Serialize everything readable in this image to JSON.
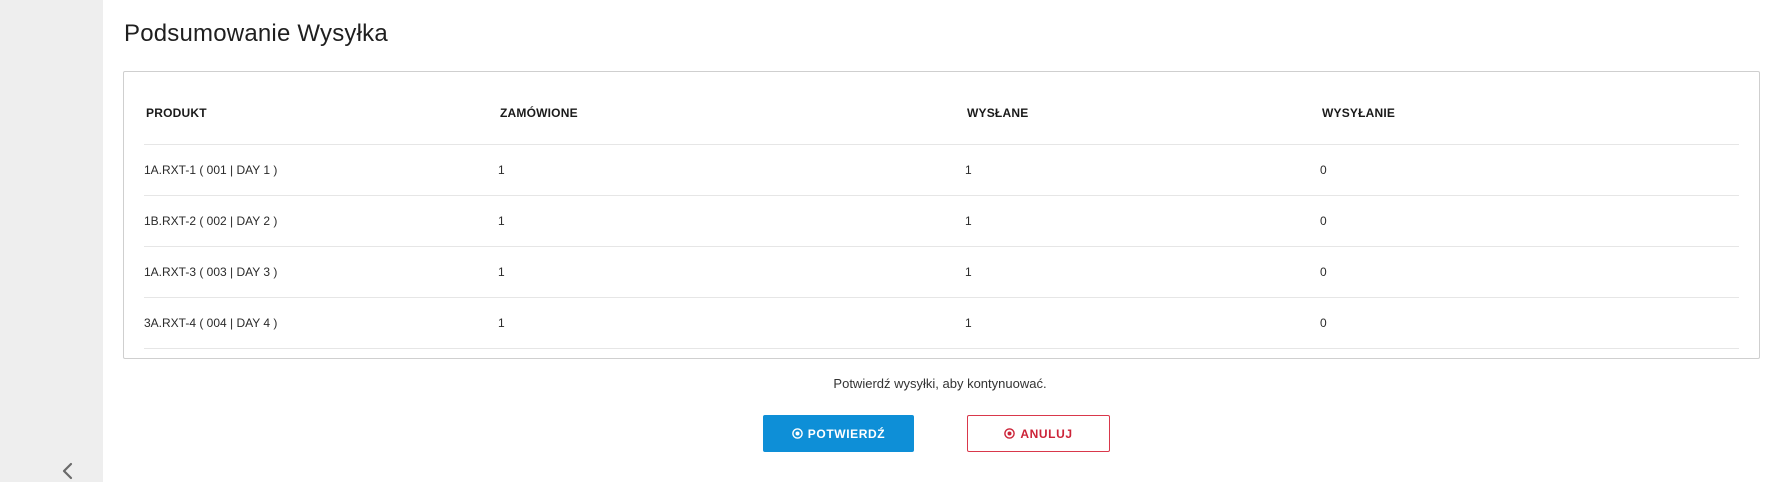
{
  "page": {
    "title": "Podsumowanie Wysyłka",
    "hint": "Potwierdź wysyłki, aby kontynuować."
  },
  "table": {
    "headers": {
      "product": "PRODUKT",
      "ordered": "ZAMÓWIONE",
      "shipped": "WYSŁANE",
      "shipping": "WYSYŁANIE"
    },
    "rows": [
      {
        "product": "1A.RXT-1 ( 001 | DAY 1 )",
        "ordered": "1",
        "shipped": "1",
        "shipping": "0"
      },
      {
        "product": "1B.RXT-2 ( 002 | DAY 2 )",
        "ordered": "1",
        "shipped": "1",
        "shipping": "0"
      },
      {
        "product": "1A.RXT-3 ( 003 | DAY 3 )",
        "ordered": "1",
        "shipped": "1",
        "shipping": "0"
      },
      {
        "product": "3A.RXT-4 ( 004 | DAY 4 )",
        "ordered": "1",
        "shipped": "1",
        "shipping": "0"
      }
    ]
  },
  "actions": {
    "confirm_label": "POTWIERDŹ",
    "cancel_label": "ANULUJ"
  },
  "icons": {
    "confirm": "check-circle-icon",
    "cancel": "times-circle-icon",
    "sidebar_toggle": "chevron-left-icon"
  },
  "colors": {
    "primary": "#0e8fd7",
    "danger": "#d9384b",
    "sidebar_bg": "#eeeeee"
  }
}
